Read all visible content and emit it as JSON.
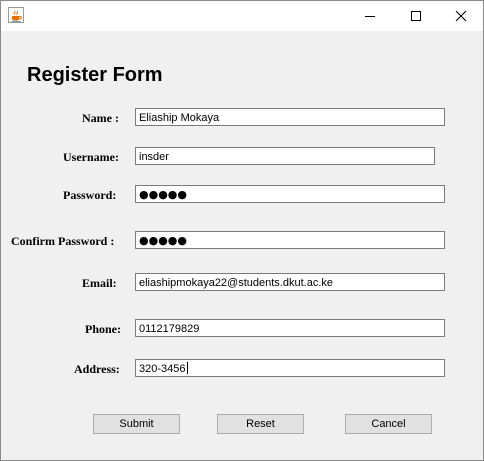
{
  "window": {
    "controls": {
      "minimize": "minimize-icon",
      "maximize": "maximize-icon",
      "close": "close-icon"
    },
    "app_icon": "java-coffee-cup-icon"
  },
  "form": {
    "title": "Register Form",
    "fields": {
      "name": {
        "label": "Name :",
        "value": "Eliaship Mokaya"
      },
      "username": {
        "label": "Username:",
        "value": "insder"
      },
      "password": {
        "label": "Password:",
        "value": "●●●●●"
      },
      "confirm_password": {
        "label": "Confirm Password :",
        "value": "●●●●●"
      },
      "email": {
        "label": "Email:",
        "value": "eliashipmokaya22@students.dkut.ac.ke"
      },
      "phone": {
        "label": "Phone:",
        "value": "0112179829"
      },
      "address": {
        "label": "Address:",
        "value": "320-3456"
      }
    },
    "buttons": {
      "submit": "Submit",
      "reset": "Reset",
      "cancel": "Cancel"
    }
  },
  "colors": {
    "background": "#f0f0f0",
    "titlebar": "#ffffff",
    "button": "#e1e1e1",
    "field_border": "#7a7a7a"
  }
}
